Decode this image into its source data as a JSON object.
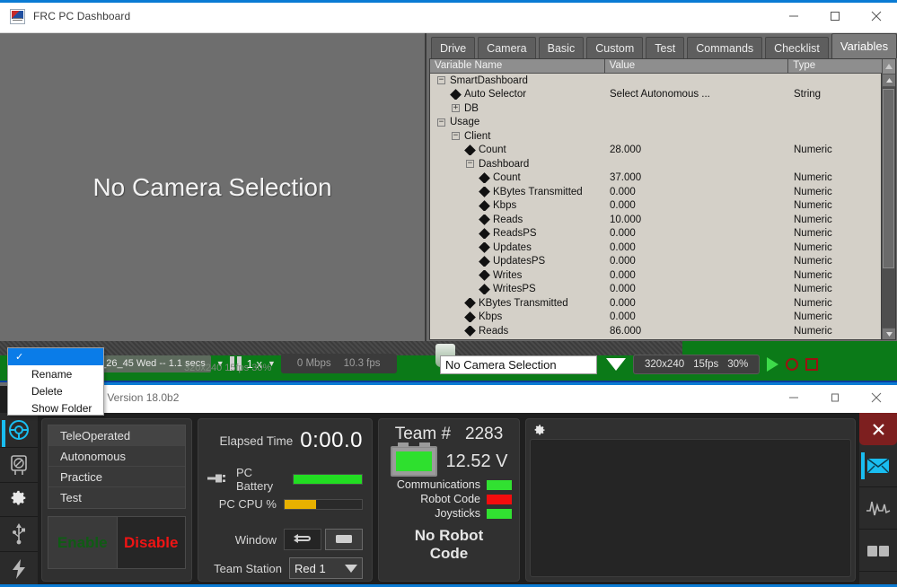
{
  "dashboard_window": {
    "title": "FRC PC Dashboard",
    "icon": "frc-dashboard-icon",
    "controls": {
      "minimize": "–",
      "maximize": "□",
      "close": "✕"
    },
    "camera": {
      "message": "No Camera Selection"
    },
    "tabs": [
      {
        "label": "Drive",
        "active": false
      },
      {
        "label": "Camera",
        "active": false
      },
      {
        "label": "Basic",
        "active": false
      },
      {
        "label": "Custom",
        "active": false
      },
      {
        "label": "Test",
        "active": false
      },
      {
        "label": "Commands",
        "active": false
      },
      {
        "label": "Checklist",
        "active": false
      },
      {
        "label": "Variables",
        "active": true
      }
    ],
    "table": {
      "columns": [
        "Variable Name",
        "Value",
        "Type"
      ],
      "rows": [
        {
          "indent": 0,
          "marker": "minus",
          "name": "SmartDashboard",
          "value": "",
          "type": ""
        },
        {
          "indent": 1,
          "marker": "leaf",
          "name": "Auto Selector",
          "value": "Select Autonomous ...",
          "type": "String"
        },
        {
          "indent": 1,
          "marker": "plus",
          "name": "DB",
          "value": "",
          "type": ""
        },
        {
          "indent": 0,
          "marker": "minus",
          "name": "Usage",
          "value": "",
          "type": ""
        },
        {
          "indent": 1,
          "marker": "minus",
          "name": "Client",
          "value": "",
          "type": ""
        },
        {
          "indent": 2,
          "marker": "leaf",
          "name": "Count",
          "value": "28.000",
          "type": "Numeric"
        },
        {
          "indent": 2,
          "marker": "minus",
          "name": "Dashboard",
          "value": "",
          "type": ""
        },
        {
          "indent": 3,
          "marker": "leaf",
          "name": "Count",
          "value": "37.000",
          "type": "Numeric"
        },
        {
          "indent": 3,
          "marker": "leaf",
          "name": "KBytes Transmitted",
          "value": "0.000",
          "type": "Numeric"
        },
        {
          "indent": 3,
          "marker": "leaf",
          "name": "Kbps",
          "value": "0.000",
          "type": "Numeric"
        },
        {
          "indent": 3,
          "marker": "leaf",
          "name": "Reads",
          "value": "10.000",
          "type": "Numeric"
        },
        {
          "indent": 3,
          "marker": "leaf",
          "name": "ReadsPS",
          "value": "0.000",
          "type": "Numeric"
        },
        {
          "indent": 3,
          "marker": "leaf",
          "name": "Updates",
          "value": "0.000",
          "type": "Numeric"
        },
        {
          "indent": 3,
          "marker": "leaf",
          "name": "UpdatesPS",
          "value": "0.000",
          "type": "Numeric"
        },
        {
          "indent": 3,
          "marker": "leaf",
          "name": "Writes",
          "value": "0.000",
          "type": "Numeric"
        },
        {
          "indent": 3,
          "marker": "leaf",
          "name": "WritesPS",
          "value": "0.000",
          "type": "Numeric"
        },
        {
          "indent": 2,
          "marker": "leaf",
          "name": "KBytes Transmitted",
          "value": "0.000",
          "type": "Numeric"
        },
        {
          "indent": 2,
          "marker": "leaf",
          "name": "Kbps",
          "value": "0.000",
          "type": "Numeric"
        },
        {
          "indent": 2,
          "marker": "leaf",
          "name": "Reads",
          "value": "86.000",
          "type": "Numeric"
        }
      ]
    },
    "playback": {
      "file": "9_26_45 Wed -- 1.1 secs",
      "resolution_ghost": "320x240  15fps  30%",
      "speed": "1 x",
      "bandwidth": "0   Mbps",
      "framerate": "10.3   fps",
      "mode_ghost": "on"
    },
    "camera_controls": {
      "selected_camera": "No Camera Selection",
      "resolution": "320x240",
      "fps": "15fps",
      "quality": "30%",
      "play": "play-icon",
      "record": "record-icon",
      "stop": "stop-icon"
    }
  },
  "context_menu": {
    "items": [
      {
        "label": "",
        "checked": true,
        "selected": true
      },
      {
        "label": "Rename",
        "checked": false,
        "selected": false
      },
      {
        "label": "Delete",
        "checked": false,
        "selected": false
      },
      {
        "label": "Show Folder",
        "checked": false,
        "selected": false
      }
    ],
    "check_glyph": "✓"
  },
  "driver_station": {
    "title": "n - Version 18.0b2",
    "controls": {
      "minimize": "–",
      "maximize": "□",
      "close": "✕"
    },
    "left_rail": [
      {
        "icon": "steering-wheel-icon",
        "active": true
      },
      {
        "icon": "gauge-icon",
        "active": false
      },
      {
        "icon": "gear-icon",
        "active": false
      },
      {
        "icon": "usb-icon",
        "active": false
      },
      {
        "icon": "lightning-bolt-icon",
        "active": false
      }
    ],
    "right_rail": [
      {
        "icon": "close-icon",
        "label": "✕"
      },
      {
        "icon": "envelope-icon",
        "active": true
      },
      {
        "icon": "waveform-icon",
        "active": false
      },
      {
        "icon": "layout-icon",
        "active": false
      }
    ],
    "modes": [
      {
        "label": "TeleOperated",
        "selected": true
      },
      {
        "label": "Autonomous",
        "selected": false
      },
      {
        "label": "Practice",
        "selected": false
      },
      {
        "label": "Test",
        "selected": false
      }
    ],
    "enable_label": "Enable",
    "disable_label": "Disable",
    "status": {
      "elapsed_label": "Elapsed Time",
      "elapsed_value": "0:00.0",
      "pc_battery_label": "PC Battery",
      "pc_battery_percent": 100,
      "pc_battery_color": "#22dd22",
      "pc_cpu_label": "PC CPU %",
      "pc_cpu_percent": 41,
      "pc_cpu_color": "#e8b100",
      "window_label": "Window",
      "team_station_label": "Team Station",
      "team_station_value": "Red 1"
    },
    "team": {
      "team_label": "Team #",
      "team_number": "2283",
      "voltage": "12.52 V",
      "battery_color": "#2ee02e",
      "indicators": [
        {
          "label": "Communications",
          "color": "#31e131"
        },
        {
          "label": "Robot Code",
          "color": "#f40d0d"
        },
        {
          "label": "Joysticks",
          "color": "#31e131"
        }
      ],
      "status_line1": "No Robot",
      "status_line2": "Code"
    },
    "messages": {
      "gear_icon": "gear-icon",
      "content": ""
    }
  }
}
